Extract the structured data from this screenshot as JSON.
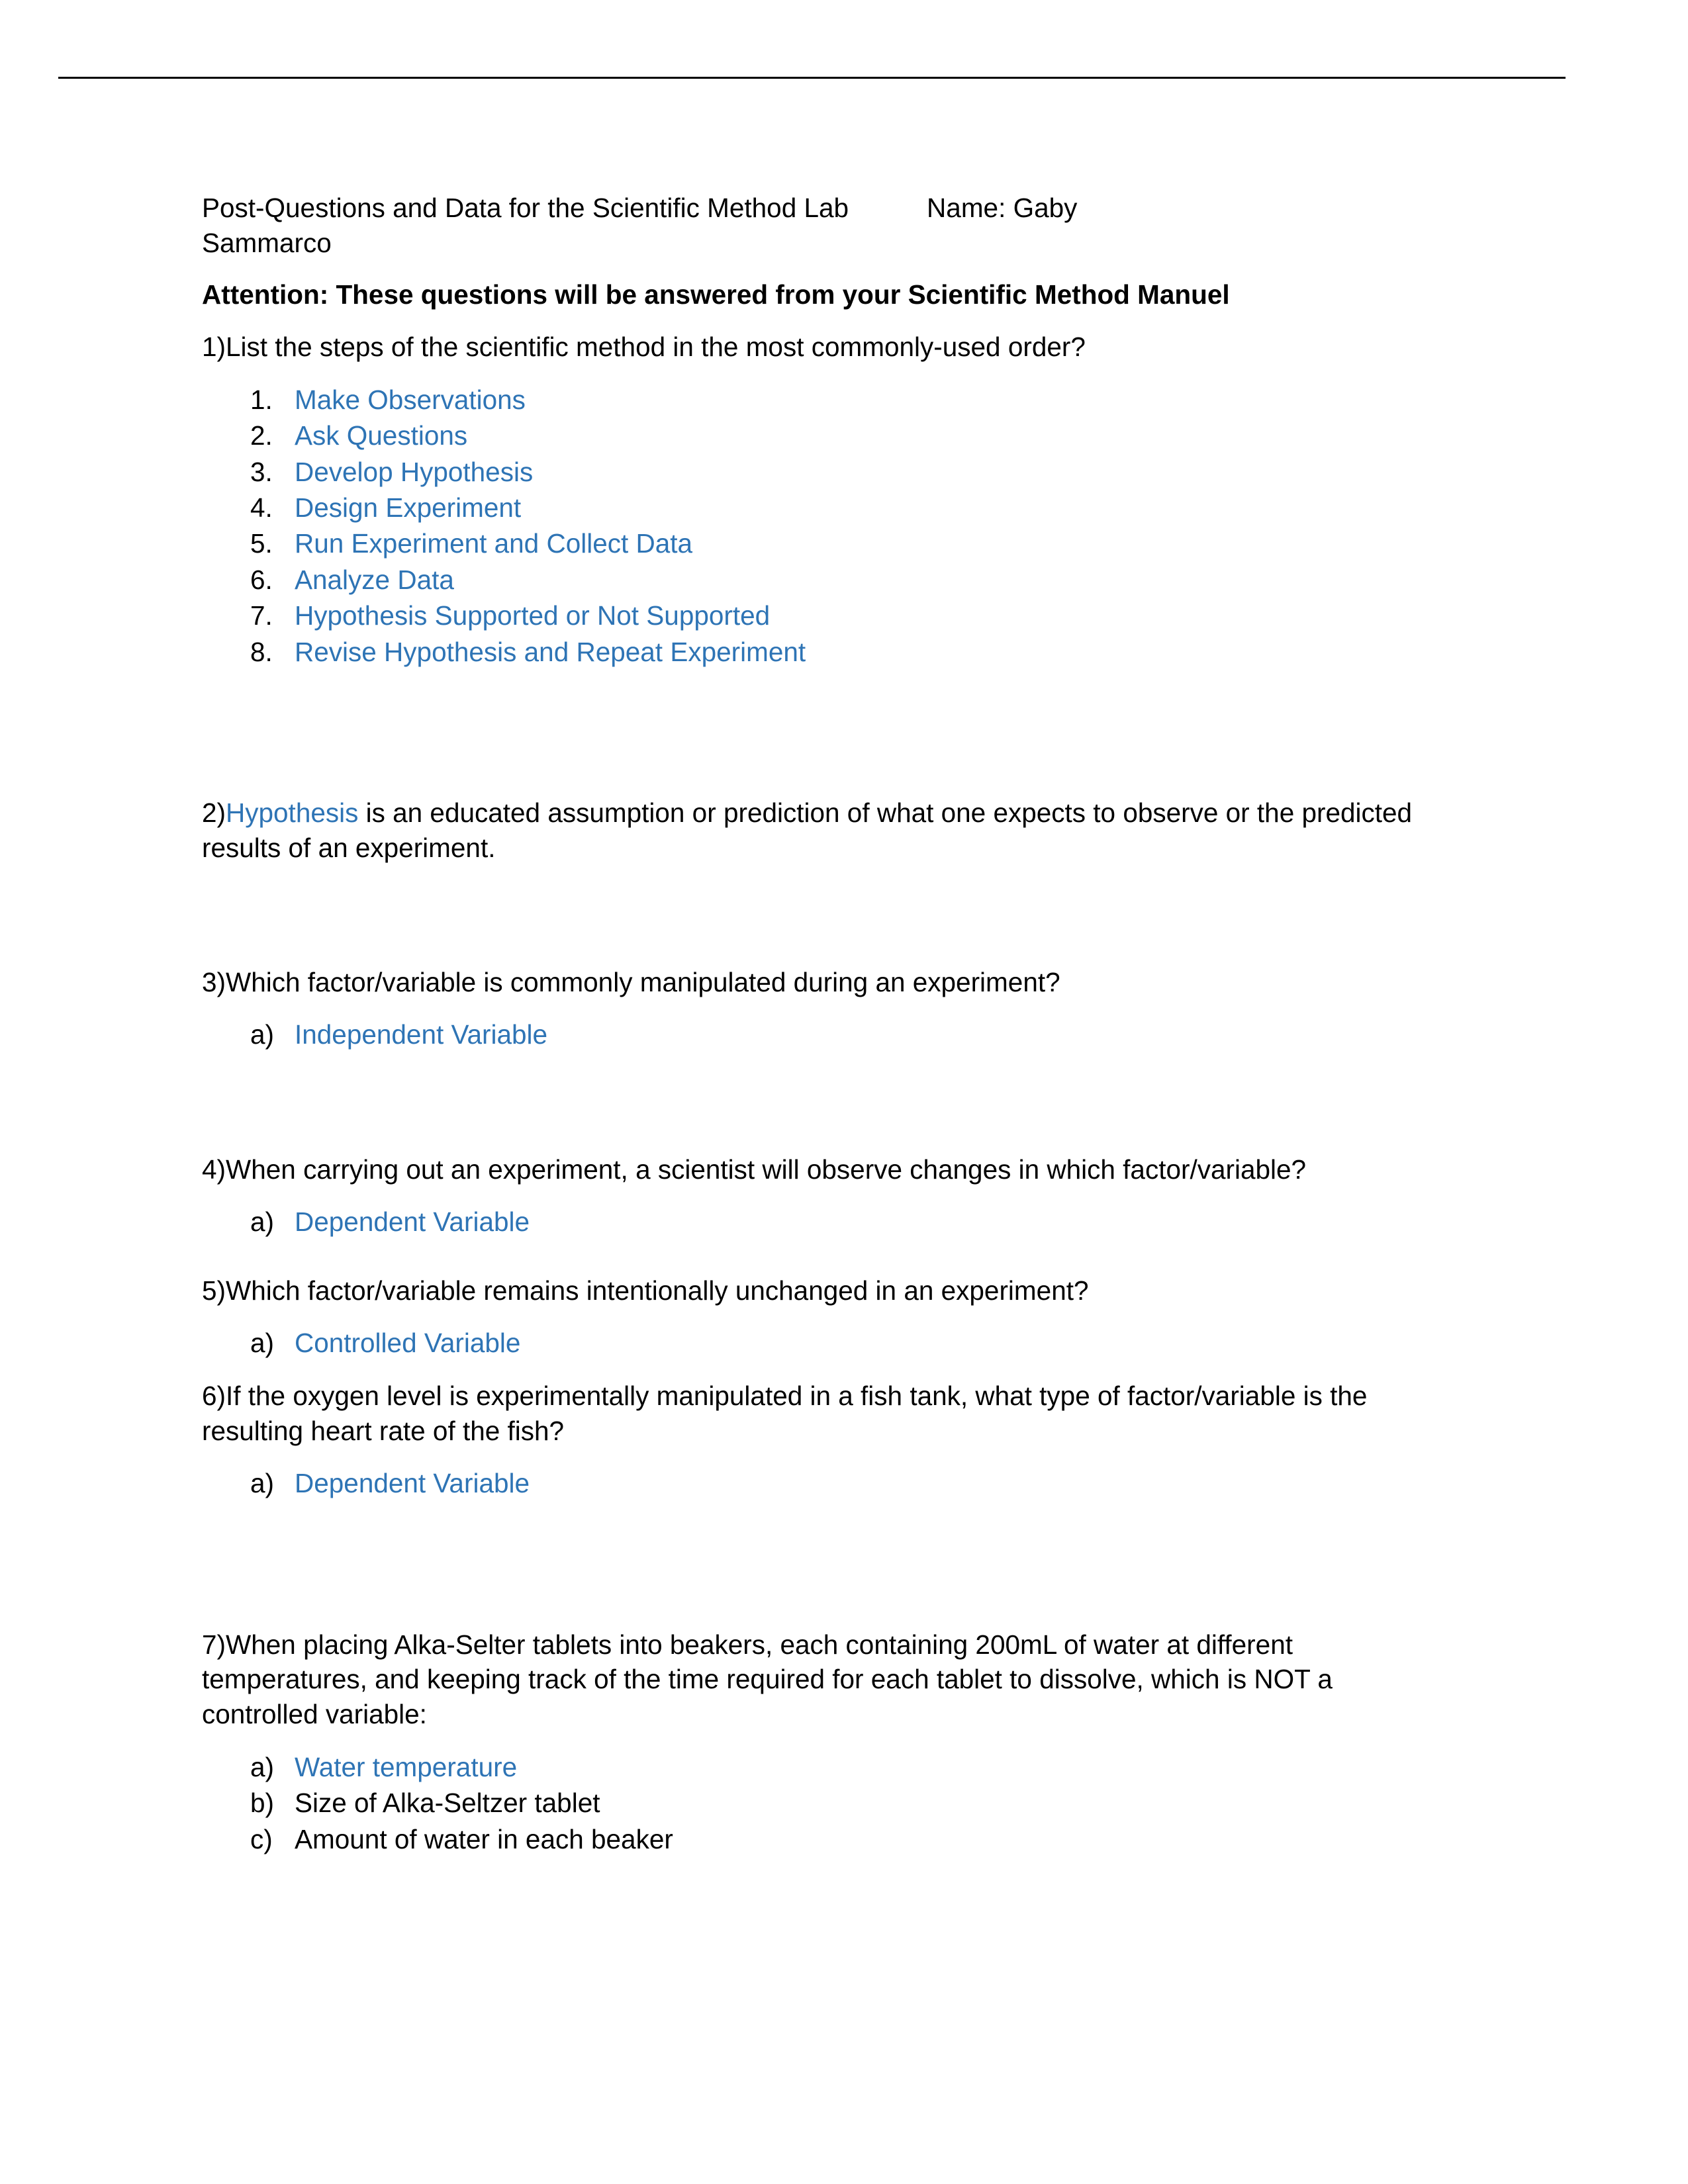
{
  "document": {
    "title_left": "Post-Questions and Data for the Scientific Method Lab",
    "title_name_line1": "Name: Gaby",
    "title_name_line2": "Sammarco",
    "attention_note": "Attention: These questions will be answered from your Scientific Method Manuel"
  },
  "colors": {
    "answer_blue": "#2e74b5",
    "body_black": "#000000"
  },
  "questions": [
    {
      "number": "1)",
      "prompt": "List the steps of the scientific method in the most commonly-used order?",
      "answer_list": [
        {
          "marker": "1.",
          "text": "Make Observations"
        },
        {
          "marker": "2.",
          "text": "Ask Questions"
        },
        {
          "marker": "3.",
          "text": "Develop Hypothesis"
        },
        {
          "marker": "4.",
          "text": "Design Experiment"
        },
        {
          "marker": "5.",
          "text": "Run Experiment and Collect Data"
        },
        {
          "marker": "6.",
          "text": "Analyze Data"
        },
        {
          "marker": "7.",
          "text": "Hypothesis Supported or Not Supported"
        },
        {
          "marker": "8.",
          "text": "Revise Hypothesis and Repeat Experiment"
        }
      ]
    },
    {
      "number": "2)",
      "inline_answer": "Hypothesis",
      "prompt_rest": " is an educated assumption or prediction of what one expects to observe or the predicted results of an experiment."
    },
    {
      "number": "3)",
      "prompt": "Which factor/variable is commonly manipulated during an experiment?",
      "choices": [
        {
          "marker": "a)",
          "text": "Independent Variable",
          "highlighted": true
        }
      ]
    },
    {
      "number": "4)",
      "prompt": "When carrying out an experiment, a scientist will observe changes in which factor/variable?",
      "choices": [
        {
          "marker": "a)",
          "text": "Dependent Variable",
          "highlighted": true
        }
      ]
    },
    {
      "number": "5)",
      "prompt": "Which factor/variable remains intentionally unchanged in an experiment?",
      "choices": [
        {
          "marker": "a)",
          "text": "Controlled Variable",
          "highlighted": true
        }
      ]
    },
    {
      "number": "6)",
      "prompt": "If the oxygen level is experimentally manipulated in a fish tank, what type of factor/variable is the resulting heart rate of the fish?",
      "choices": [
        {
          "marker": "a)",
          "text": "Dependent Variable",
          "highlighted": true
        }
      ]
    },
    {
      "number": "7)",
      "prompt": "When placing Alka-Selter tablets into beakers, each containing 200mL of water at different temperatures, and keeping track of the time required for each tablet to dissolve, which is NOT a controlled variable:",
      "choices": [
        {
          "marker": "a)",
          "text": "Water temperature",
          "highlighted": true
        },
        {
          "marker": "b)",
          "text": "Size of Alka-Seltzer tablet",
          "highlighted": false
        },
        {
          "marker": "c)",
          "text": "Amount of water in each beaker",
          "highlighted": false
        }
      ]
    }
  ]
}
